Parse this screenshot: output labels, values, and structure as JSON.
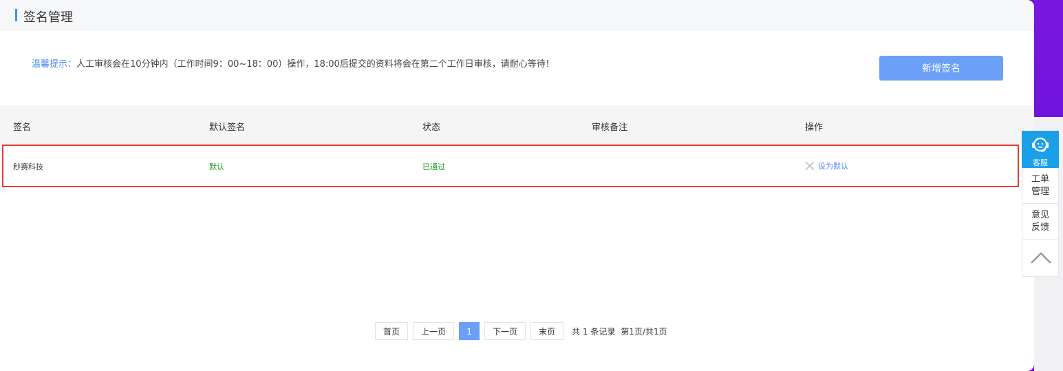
{
  "page": {
    "title": "签名管理",
    "notice_label": "温馨提示：",
    "notice_text": "人工审核会在10分钟内（工作时间9：00~18：00）操作，18:00后提交的资料将会在第二个工作日审核，请耐心等待！",
    "add_button": "新增签名"
  },
  "table": {
    "headers": [
      "签名",
      "默认签名",
      "状态",
      "审核备注",
      "操作"
    ],
    "rows": [
      {
        "name": "秒赛科技",
        "default": "默认",
        "status": "已通过",
        "remark": "",
        "action": "设为默认"
      }
    ]
  },
  "pagination": {
    "first": "首页",
    "prev": "上一页",
    "current": "1",
    "next": "下一页",
    "last": "末页",
    "total": "共 1 条记录",
    "page_info": "第1页/共1页"
  },
  "float_bar": {
    "service": "客服",
    "ticket_line1": "工单",
    "ticket_line2": "管理",
    "feedback_line1": "意见",
    "feedback_line2": "反馈"
  },
  "colors": {
    "accent": "#4a8af4",
    "button": "#6b9ff8",
    "success": "#2aa32a",
    "highlight": "#e53935",
    "service": "#1aa0e8"
  }
}
